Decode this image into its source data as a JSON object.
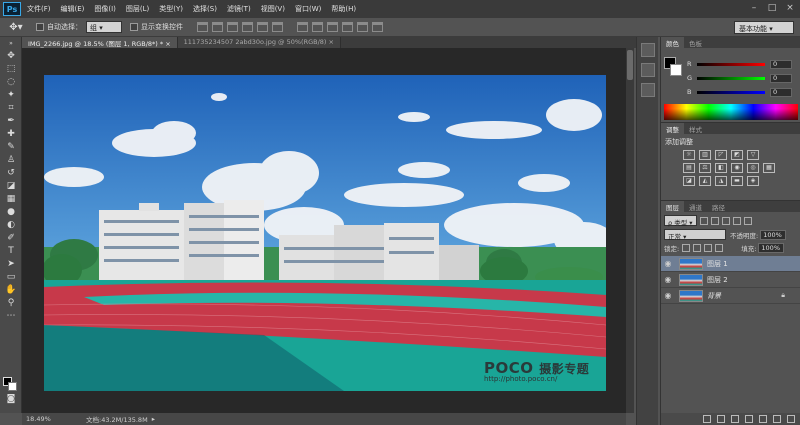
{
  "app": {
    "logo": "Ps"
  },
  "menu": [
    "文件(F)",
    "编辑(E)",
    "图像(I)",
    "图层(L)",
    "类型(Y)",
    "选择(S)",
    "滤镜(T)",
    "视图(V)",
    "窗口(W)",
    "帮助(H)"
  ],
  "options": {
    "auto_select_label": "自动选择：",
    "auto_select_value": "组",
    "show_transform_label": "显示变换控件",
    "workspace": "基本功能"
  },
  "tabs": [
    {
      "label": "IMG_2266.jpg @ 18.5% (图层 1, RGB/8*) * ×"
    },
    {
      "label": "111735234507 2abd30o.jpg @ 50%(RGB/8) ×"
    }
  ],
  "status": {
    "zoom": "18.49%",
    "doc": "文档:43.2M/135.8M"
  },
  "watermark": {
    "brand": "POCO",
    "brand_cn": "摄影专题",
    "url": "http://photo.poco.cn/"
  },
  "color_panel": {
    "tabs": [
      "颜色",
      "色板"
    ],
    "r_label": "R",
    "g_label": "G",
    "b_label": "B",
    "r": "0",
    "g": "0",
    "b": "0",
    "fg_color": "#000000",
    "bg_color": "#ffffff"
  },
  "adjust_panel": {
    "tabs": [
      "调整",
      "样式"
    ],
    "add_label": "添加调整"
  },
  "layers_panel": {
    "tabs": [
      "图层",
      "通道",
      "路径"
    ],
    "kind_filter": "ρ 类型",
    "blend_mode": "正常",
    "opacity_label": "不透明度:",
    "opacity": "100%",
    "lock_label": "锁定:",
    "fill_label": "填充:",
    "fill": "100%",
    "layers": [
      {
        "name": "图层 1",
        "active": true
      },
      {
        "name": "图层 2",
        "active": false
      },
      {
        "name": "背景",
        "active": false
      }
    ]
  },
  "colors": {
    "accent": "#38a8e8",
    "sky": "#2f77c9",
    "track": "#c93a3a",
    "field": "#1aa89a"
  }
}
